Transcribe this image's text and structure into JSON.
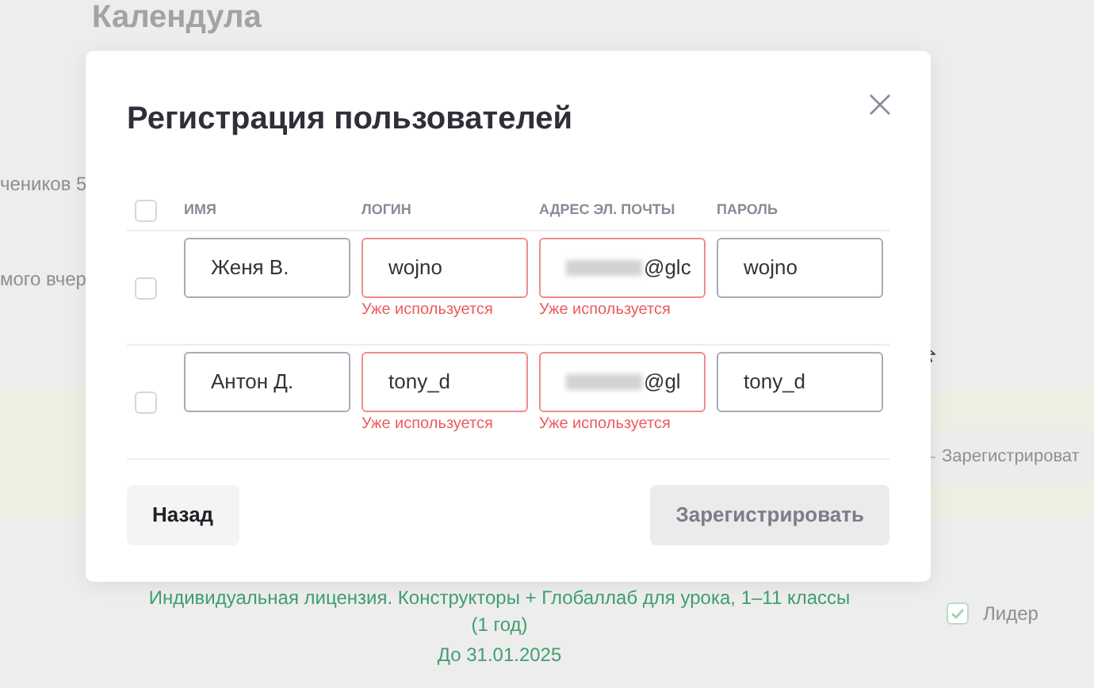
{
  "background": {
    "heading": "Календула",
    "line_1": "чеников 5",
    "line_2": "мого вчер",
    "side_action": "Зарегистрироват",
    "license": "Индивидуальная лицензия. Конструкторы + Глобаллаб для урока, 1–11 классы",
    "license_term": "(1 год)",
    "license_until": "До 31.01.2025",
    "role": {
      "label": "Лидер",
      "checked": true
    }
  },
  "dialog": {
    "title": "Регистрация пользователей",
    "select_all": {
      "checked": false
    },
    "columns": [
      "ИМЯ",
      "ЛОГИН",
      "АДРЕС ЭЛ. ПОЧТЫ",
      "ПАРОЛЬ"
    ],
    "rows": [
      {
        "checked": false,
        "fields": [
          {
            "kind": "text",
            "value": "Женя В.",
            "error": false
          },
          {
            "kind": "text",
            "value": "wojno",
            "error": true,
            "error_text": "Уже используется"
          },
          {
            "kind": "blurred",
            "value": "@glc",
            "error": true,
            "error_text": "Уже используется"
          },
          {
            "kind": "text",
            "value": "wojno",
            "error": false
          }
        ]
      },
      {
        "checked": false,
        "fields": [
          {
            "kind": "text",
            "value": "Антон Д.",
            "error": false
          },
          {
            "kind": "text",
            "value": "tony_d",
            "error": true,
            "error_text": "Уже используется"
          },
          {
            "kind": "blurred",
            "value": "@gl",
            "error": true,
            "error_text": "Уже используется"
          },
          {
            "kind": "text",
            "value": "tony_d",
            "error": false
          }
        ]
      }
    ],
    "buttons": [
      {
        "label": "Назад",
        "disabled": false
      },
      {
        "label": "Зарегистрировать",
        "disabled": true
      }
    ]
  }
}
